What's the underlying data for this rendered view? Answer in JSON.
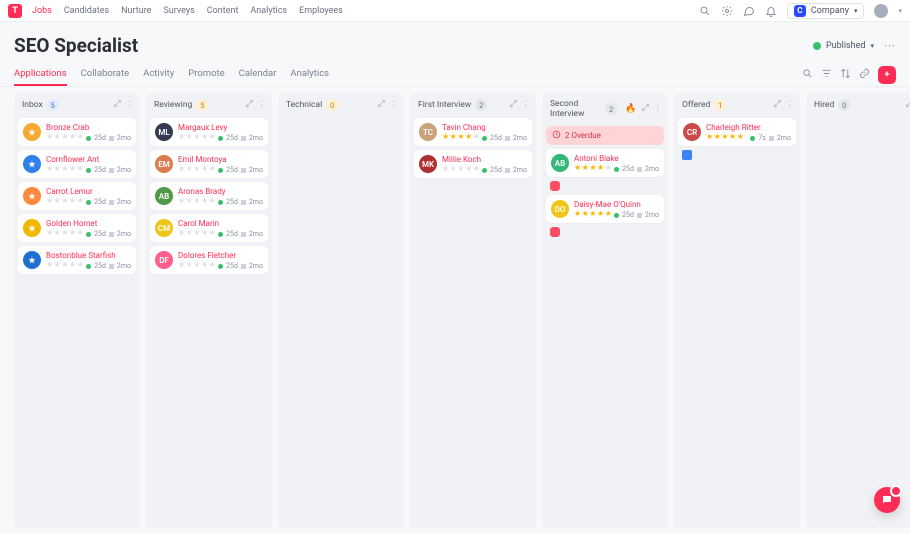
{
  "brand": {
    "initial": "T"
  },
  "nav": {
    "items": [
      {
        "label": "Jobs"
      },
      {
        "label": "Candidates"
      },
      {
        "label": "Nurture"
      },
      {
        "label": "Surveys"
      },
      {
        "label": "Content"
      },
      {
        "label": "Analytics"
      },
      {
        "label": "Employees"
      }
    ],
    "company": {
      "initial": "C",
      "label": "Company"
    }
  },
  "job": {
    "title": "SEO Specialist",
    "status": "Published"
  },
  "tabs": [
    {
      "label": "Applications"
    },
    {
      "label": "Collaborate"
    },
    {
      "label": "Activity"
    },
    {
      "label": "Promote"
    },
    {
      "label": "Calendar"
    },
    {
      "label": "Analytics"
    }
  ],
  "columns": [
    {
      "title": "Inbox",
      "count": "5",
      "count_style": "blue",
      "cards": [
        {
          "name": "Bronze Crab",
          "avatar_bg": "#f7a832",
          "initials": "★",
          "rating": 0,
          "age": "25d",
          "time": "2mo"
        },
        {
          "name": "Cornflower Ant",
          "avatar_bg": "#2f80ed",
          "initials": "★",
          "rating": 0,
          "age": "25d",
          "time": "2mo"
        },
        {
          "name": "Carrot Lemur",
          "avatar_bg": "#ff8a3d",
          "initials": "★",
          "rating": 0,
          "age": "25d",
          "time": "2mo"
        },
        {
          "name": "Golden Hornet",
          "avatar_bg": "#f2b705",
          "initials": "★",
          "rating": 0,
          "age": "25d",
          "time": "2mo"
        },
        {
          "name": "Bostonblue Starfish",
          "avatar_bg": "#1f6fd1",
          "initials": "★",
          "rating": 0,
          "age": "25d",
          "time": "2mo"
        }
      ]
    },
    {
      "title": "Reviewing",
      "count": "5",
      "count_style": "amber",
      "cards": [
        {
          "name": "Margaux Levy",
          "avatar_bg": "#333a52",
          "initials": "ML",
          "rating": 0,
          "age": "25d",
          "time": "2mo"
        },
        {
          "name": "Emil Montoya",
          "avatar_bg": "#d97c4f",
          "initials": "EM",
          "rating": 0,
          "age": "25d",
          "time": "2mo"
        },
        {
          "name": "Aronas Brady",
          "avatar_bg": "#4f9a4a",
          "initials": "AB",
          "rating": 0,
          "age": "25d",
          "time": "2mo"
        },
        {
          "name": "Carol Marin",
          "avatar_bg": "#f0c419",
          "initials": "CM",
          "rating": 0,
          "age": "25d",
          "time": "2mo"
        },
        {
          "name": "Dolores Fletcher",
          "avatar_bg": "#ff5f8a",
          "initials": "DF",
          "rating": 0,
          "age": "25d",
          "time": "2mo"
        }
      ]
    },
    {
      "title": "Technical",
      "count": "0",
      "count_style": "amber",
      "cards": []
    },
    {
      "title": "First Interview",
      "count": "2",
      "count_style": "gray",
      "cards": [
        {
          "name": "Tavin Chang",
          "avatar_bg": "#caa37a",
          "initials": "TC",
          "rating": 4,
          "age": "25d",
          "time": "2mo"
        },
        {
          "name": "Millie Koch",
          "avatar_bg": "#b03030",
          "initials": "MK",
          "rating": 0,
          "age": "25d",
          "time": "2mo"
        }
      ]
    },
    {
      "title": "Second Interview",
      "count": "2",
      "count_style": "gray",
      "show_fire": true,
      "overdue": "2 Overdue",
      "cards": [
        {
          "name": "Antoni Blake",
          "avatar_bg": "#32b778",
          "initials": "AB",
          "rating": 4,
          "age": "25d",
          "time": "2mo",
          "flag": true
        },
        {
          "name": "Daisy-Mae O'Quinn",
          "avatar_bg": "#f0c419",
          "initials": "DO",
          "rating": 5,
          "age": "25d",
          "time": "2mo",
          "flag": true
        }
      ]
    },
    {
      "title": "Offered",
      "count": "1",
      "count_style": "amber",
      "cards": [
        {
          "name": "Charleigh Ritter",
          "avatar_bg": "#c94a4a",
          "initials": "CR",
          "rating": 5,
          "age": "7s",
          "time": "2mo"
        }
      ],
      "extra_link": true
    },
    {
      "title": "Hired",
      "count": "0",
      "count_style": "gray",
      "cards": []
    }
  ],
  "colors": {
    "accent": "#ff2d55",
    "success": "#35c26b",
    "warning": "#ffb400"
  }
}
